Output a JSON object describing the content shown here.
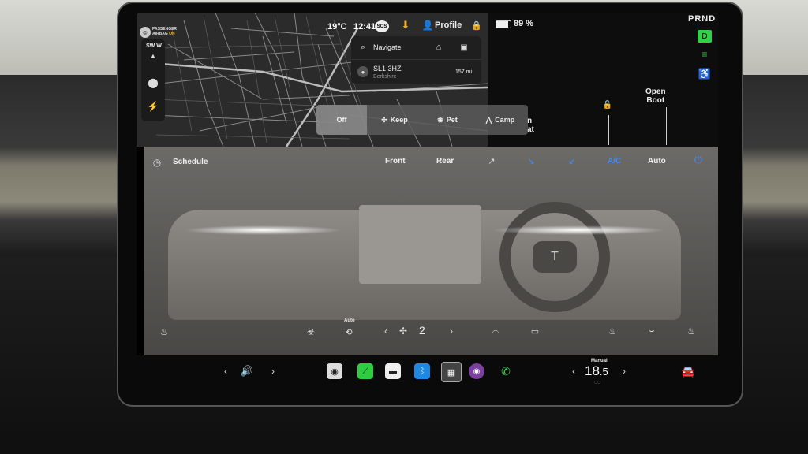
{
  "status": {
    "airbag_label": "PASSENGER",
    "airbag_label2": "AIRBAG",
    "airbag_state": "ON",
    "temperature": "19°C",
    "time": "12:41",
    "sos": "SOS",
    "profile": "Profile",
    "battery": "89 %",
    "gear": "PRND"
  },
  "map": {
    "compass": "SW",
    "compass_w": "W"
  },
  "navigation": {
    "placeholder": "Navigate",
    "destination_name": "SL1 3HZ",
    "destination_sub": "Berkshire",
    "destination_distance": "157 mi"
  },
  "controls": {
    "open_boot": "Open\nBoot",
    "frunk_partial": "n\nat"
  },
  "climate_modes": {
    "off": "Off",
    "keep": "Keep",
    "pet": "Pet",
    "camp": "Camp"
  },
  "climate_bar": {
    "schedule": "Schedule",
    "front": "Front",
    "rear": "Rear",
    "ac": "A/C",
    "auto": "Auto"
  },
  "climate_bottom": {
    "auto_recirc": "Auto",
    "fan_speed": "2"
  },
  "dock": {
    "temp_mode": "Manual",
    "temp_value": "18",
    "temp_decimal": ".5"
  },
  "colors": {
    "accent_blue": "#3d8bff",
    "green": "#35d04a",
    "red": "#e53935",
    "airbag_on": "#f5b324"
  }
}
